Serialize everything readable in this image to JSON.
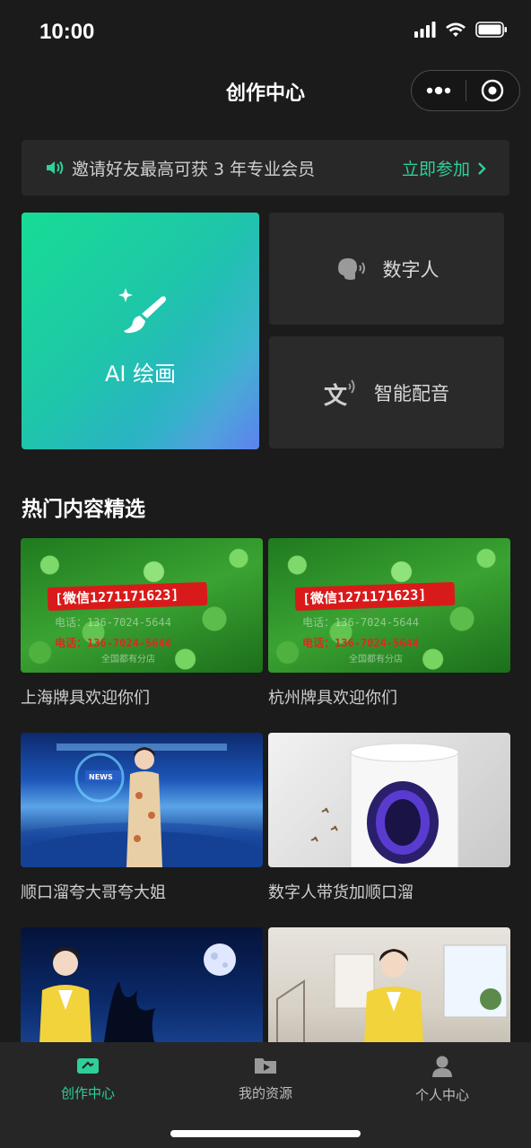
{
  "status_bar": {
    "time": "10:00"
  },
  "nav": {
    "title": "创作中心"
  },
  "invite": {
    "text": "邀请好友最高可获 3 年专业会员",
    "action": "立即参加"
  },
  "tools": {
    "ai_painting": "AI 绘画",
    "digital_human": "数字人",
    "smart_dubbing": "智能配音"
  },
  "section": {
    "title": "热门内容精选"
  },
  "videos": [
    {
      "caption": "上海牌具欢迎你们",
      "overlay": {
        "band": "[微信1271171623]",
        "line1": "电话：136-7024-5644",
        "line2": "电话：136-7024-5644",
        "line3": "全国都有分店"
      }
    },
    {
      "caption": "杭州牌具欢迎你们",
      "overlay": {
        "band": "[微信1271171623]",
        "line1": "电话：136-7024-5644",
        "line2": "电话：136-7024-5644",
        "line3": "全国都有分店"
      }
    },
    {
      "caption": "顺口溜夸大哥夸大姐",
      "overlay": {
        "tag": "NEWS"
      }
    },
    {
      "caption": "数字人带货加顺口溜"
    },
    {
      "caption": ""
    },
    {
      "caption": ""
    }
  ],
  "tabs": [
    {
      "label": "创作中心",
      "icon": "camera-icon",
      "active": true
    },
    {
      "label": "我的资源",
      "icon": "play-folder-icon",
      "active": false
    },
    {
      "label": "个人中心",
      "icon": "person-icon",
      "active": false
    }
  ],
  "colors": {
    "accent": "#2fcf9a",
    "background": "#1b1b1b",
    "card": "#2a2a2a"
  }
}
